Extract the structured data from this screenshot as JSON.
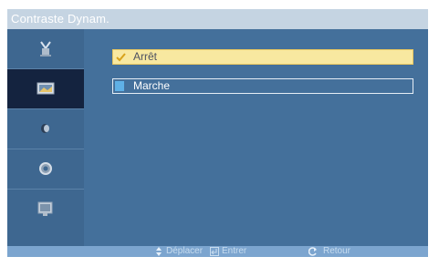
{
  "header": {
    "title": "Contraste Dynam."
  },
  "sidebar": {
    "items": [
      {
        "icon": "antenna-icon",
        "selected": false
      },
      {
        "icon": "picture-icon",
        "selected": true
      },
      {
        "icon": "sound-icon",
        "selected": false
      },
      {
        "icon": "setup-icon",
        "selected": false
      },
      {
        "icon": "input-icon",
        "selected": false
      }
    ]
  },
  "options": [
    {
      "label": "Arrêt",
      "selected": true
    },
    {
      "label": "Marche",
      "selected": false
    }
  ],
  "footer": {
    "move_label": "Déplacer",
    "enter_label": "Entrer",
    "return_label": "Retour"
  },
  "colors": {
    "background": "#44709b",
    "sidebar_selected": "#14233f",
    "highlight": "#f8e8a0",
    "title_bar": "#c5d4e2",
    "footer": "#7ca5cf"
  }
}
